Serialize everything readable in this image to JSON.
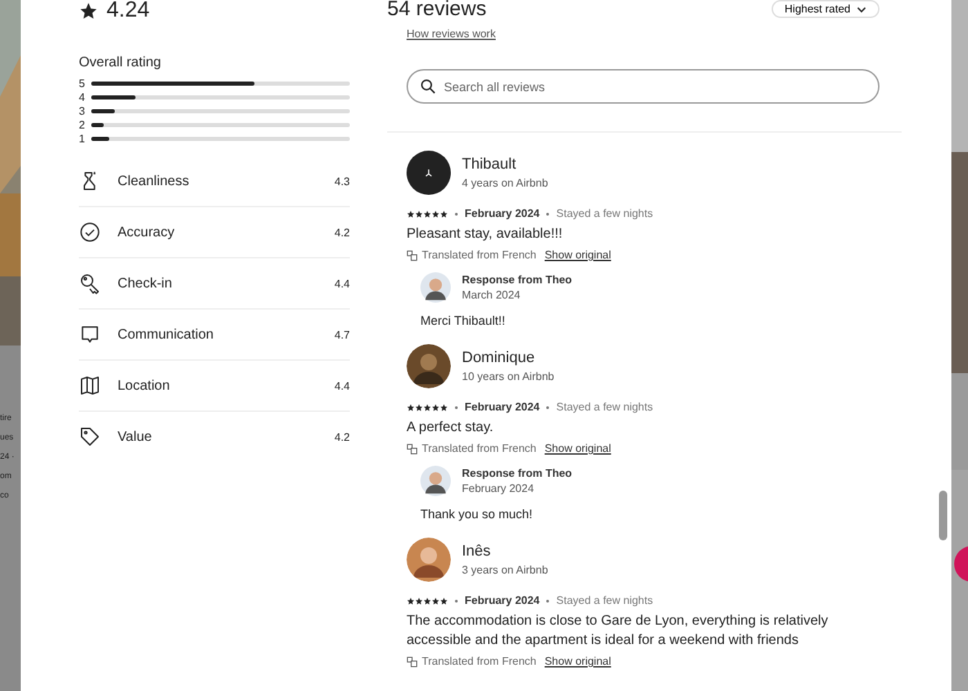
{
  "background_left": {
    "fragments": [
      "tire",
      "ues",
      "24 ·",
      "om",
      "co"
    ]
  },
  "rating": {
    "value": "4.24",
    "label": "Overall rating",
    "distribution": [
      {
        "label": "5",
        "level": 0.63
      },
      {
        "label": "4",
        "level": 0.17
      },
      {
        "label": "3",
        "level": 0.09
      },
      {
        "label": "2",
        "level": 0.05
      },
      {
        "label": "1",
        "level": 0.07
      }
    ]
  },
  "categories": [
    {
      "name": "Cleanliness",
      "score": "4.3"
    },
    {
      "name": "Accuracy",
      "score": "4.2"
    },
    {
      "name": "Check-in",
      "score": "4.4"
    },
    {
      "name": "Communication",
      "score": "4.7"
    },
    {
      "name": "Location",
      "score": "4.4"
    },
    {
      "name": "Value",
      "score": "4.2"
    }
  ],
  "reviews_header": {
    "title": "54 reviews",
    "link": "How reviews work",
    "sort": "Highest rated"
  },
  "search": {
    "placeholder": "Search all reviews"
  },
  "reviews": [
    {
      "name": "Thibault",
      "tenure": "4 years on Airbnb",
      "kind": "logo",
      "stars": 5,
      "date": "February 2024",
      "stay": "Stayed a few nights",
      "text": "Pleasant stay, available!!!",
      "translated": "Translated from French",
      "show_original": "Show original",
      "response": {
        "title": "Response from Theo",
        "date": "March 2024",
        "text": "Merci Thibault!!"
      }
    },
    {
      "name": "Dominique",
      "tenure": "10 years on Airbnb",
      "stars": 5,
      "date": "February 2024",
      "stay": "Stayed a few nights",
      "text": "A perfect stay.",
      "translated": "Translated from French",
      "show_original": "Show original",
      "response": {
        "title": "Response from Theo",
        "date": "February 2024",
        "text": "Thank you so much!"
      }
    },
    {
      "name": "Inês",
      "tenure": "3 years on Airbnb",
      "stars": 5,
      "date": "February 2024",
      "stay": "Stayed a few nights",
      "text": "The accommodation is close to Gare de Lyon, everything is relatively accessible and the apartment is ideal for a weekend with friends",
      "translated": "Translated from French",
      "show_original": "Show original"
    }
  ]
}
